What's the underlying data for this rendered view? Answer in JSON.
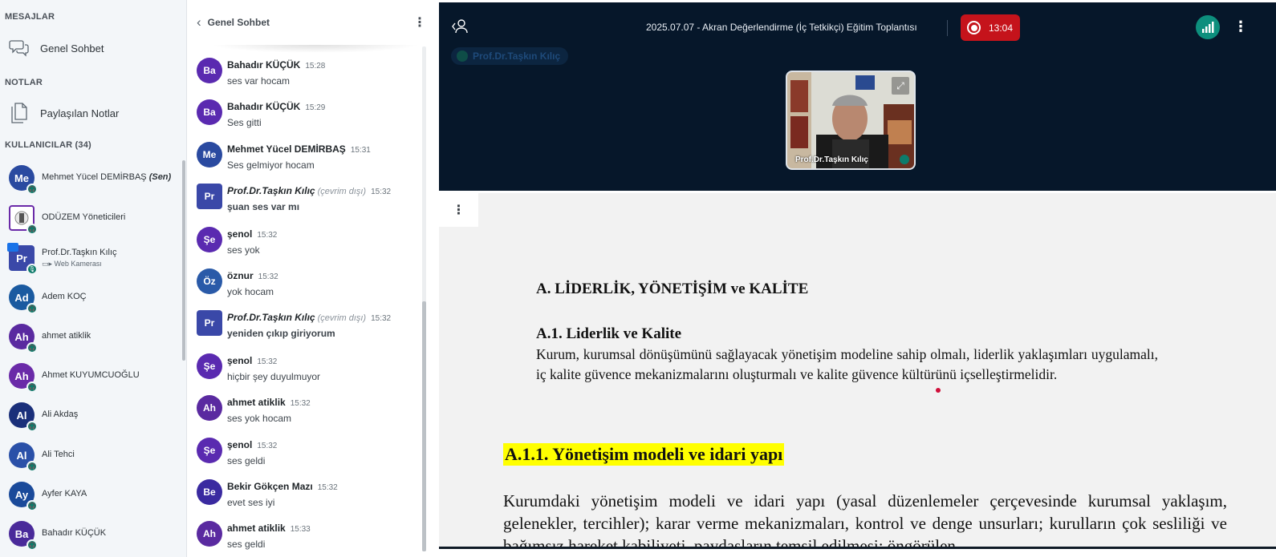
{
  "sidebar": {
    "messages_title": "MESAJLAR",
    "general_chat": "Genel Sohbet",
    "notes_title": "NOTLAR",
    "shared_notes": "Paylaşılan Notlar",
    "users_title": "KULLANICILAR (34)",
    "you_suffix": "(Sen)",
    "users": [
      {
        "initials": "Me",
        "name": "Mehmet Yücel DEMİRBAŞ",
        "color": "#2a4aa0"
      },
      {
        "initials": "",
        "name": "ODÜZEM Yöneticileri",
        "color": "#ffffff"
      },
      {
        "initials": "Pr",
        "name": "Prof.Dr.Taşkın Kılıç",
        "sub": "Web Kamerası",
        "color": "#3a48a8"
      },
      {
        "initials": "Ad",
        "name": "Adem KOÇ",
        "color": "#1a5aa0"
      },
      {
        "initials": "Ah",
        "name": "ahmet atiklik",
        "color": "#5a2aa0"
      },
      {
        "initials": "Ah",
        "name": "Ahmet KUYUMCUOĞLU",
        "color": "#6a2aa8"
      },
      {
        "initials": "Al",
        "name": "Ali Akdaş",
        "color": "#1a2f7a"
      },
      {
        "initials": "Al",
        "name": "Ali Tehci",
        "color": "#2a50a8"
      },
      {
        "initials": "Ay",
        "name": "Ayfer KAYA",
        "color": "#1a4a9a"
      },
      {
        "initials": "Ba",
        "name": "Bahadır KÜÇÜK",
        "color": "#4a2a9a"
      }
    ]
  },
  "chat": {
    "title": "Genel Sohbet",
    "offline_label": "(çevrim dışı)",
    "messages": [
      {
        "initials": "Ba",
        "sender": "Bahadır KÜÇÜK",
        "time": "15:28",
        "text": "ses var hocam",
        "color": "#5a2ab0"
      },
      {
        "initials": "Ba",
        "sender": "Bahadır KÜÇÜK",
        "time": "15:29",
        "text": "Ses gitti",
        "color": "#5a2ab0"
      },
      {
        "initials": "Me",
        "sender": "Mehmet Yücel DEMİRBAŞ",
        "time": "15:31",
        "text": "Ses gelmiyor hocam",
        "color": "#2a4aa0"
      },
      {
        "initials": "Pr",
        "sender": "Prof.Dr.Taşkın Kılıç",
        "time": "15:32",
        "text": "şuan ses var mı",
        "color": "#3a48a8"
      },
      {
        "initials": "Şe",
        "sender": "şenol",
        "time": "15:32",
        "text": "ses yok",
        "color": "#5a2ab0"
      },
      {
        "initials": "Öz",
        "sender": "öznur",
        "time": "15:32",
        "text": "yok hocam",
        "color": "#2a5aa8"
      },
      {
        "initials": "Pr",
        "sender": "Prof.Dr.Taşkın Kılıç",
        "time": "15:32",
        "text": "yeniden çıkıp giriyorum",
        "color": "#3a48a8"
      },
      {
        "initials": "Şe",
        "sender": "şenol",
        "time": "15:32",
        "text": "hiçbir şey duyulmuyor",
        "color": "#5a2ab0"
      },
      {
        "initials": "Ah",
        "sender": "ahmet atiklik",
        "time": "15:32",
        "text": "ses yok hocam",
        "color": "#5a2aa0"
      },
      {
        "initials": "Şe",
        "sender": "şenol",
        "time": "15:32",
        "text": "ses geldi",
        "color": "#5a2ab0"
      },
      {
        "initials": "Be",
        "sender": "Bekir Gökçen Mazı",
        "time": "15:32",
        "text": "evet ses iyi",
        "color": "#3a2aa0"
      },
      {
        "initials": "Ah",
        "sender": "ahmet atiklik",
        "time": "15:33",
        "text": "ses geldi",
        "color": "#5a2aa0"
      }
    ]
  },
  "meeting": {
    "title": "2025.07.07 - Akran Değerlendirme (İç Tetkikçi) Eğitim Toplantısı",
    "recording_time": "13:04",
    "talking_user": "Prof.Dr.Taşkın Kılıç",
    "video_name": "Prof.Dr.Taşkın Kılıç"
  },
  "slide": {
    "heading1": "A. LİDERLİK, YÖNETİŞİM ve KALİTE",
    "heading2": "A.1. Liderlik ve Kalite",
    "paragraph1": "Kurum, kurumsal dönüşümünü sağlayacak yönetişim modeline sahip olmalı, liderlik yaklaşımları uygulamalı, iç kalite güvence mekanizmalarını oluşturmalı ve kalite güvence kültürünü içselleştirmelidir.",
    "heading3": "A.1.1. Yönetişim modeli ve idari yapı",
    "paragraph2": "Kurumdaki yönetişim modeli ve idari yapı (yasal düzenlemeler çerçevesinde kurumsal yaklaşım, gelenekler, tercihler); karar verme mekanizmaları, kontrol ve denge unsurları; kurulların çok sesliliği ve bağımsız hareket kabiliyeti, paydaşların temsil edilmesi; öngörülen"
  },
  "colors": {
    "topbar": "#06172a",
    "record": "#c5131b",
    "highlight": "#ffff00",
    "connection": "#0d8f7d"
  }
}
